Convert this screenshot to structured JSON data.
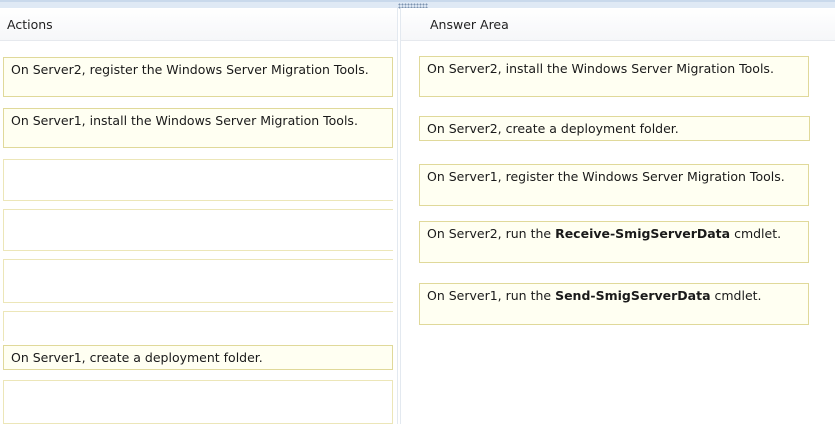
{
  "actions_panel": {
    "title": "Actions",
    "items": [
      "On Server2, register the Windows Server Migration Tools.",
      "On Server1, install the Windows Server Migration Tools.",
      "On Server1, create a deployment folder."
    ]
  },
  "answer_panel": {
    "title": "Answer Area",
    "items": [
      {
        "text": "On Server2, install the Windows Server Migration Tools."
      },
      {
        "text": "On Server2, create a deployment folder."
      },
      {
        "text": "On Server1, register the Windows Server Migration Tools."
      },
      {
        "pre": "On Server2, run the ",
        "bold": "Receive-SmigServerData",
        "post": " cmdlet."
      },
      {
        "pre": "On Server1, run the ",
        "bold": "Send-SmigServerData",
        "post": " cmdlet."
      }
    ]
  },
  "colors": {
    "item_background": "#fffff2",
    "item_border": "#e0d99a",
    "header_bar": "#dfe9f5"
  }
}
